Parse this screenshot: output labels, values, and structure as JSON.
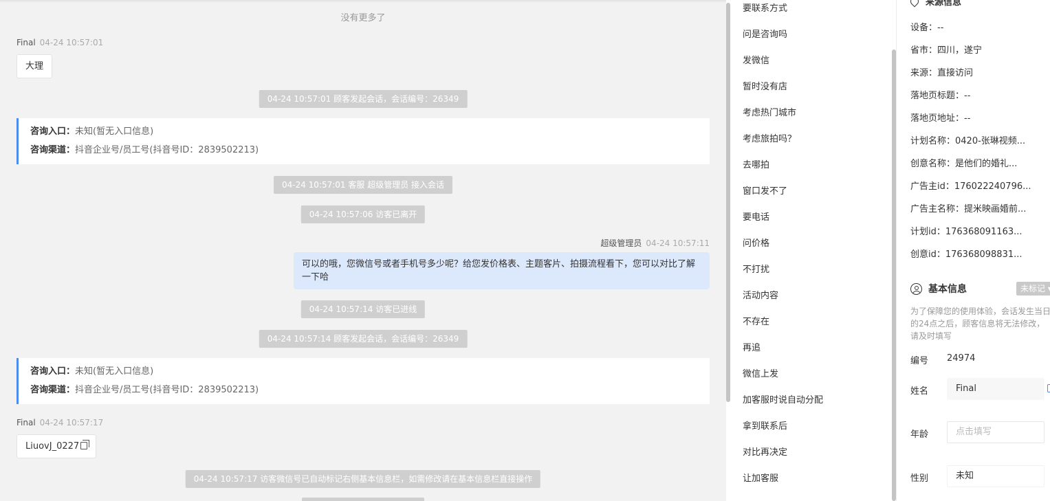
{
  "chat": {
    "no_more": "没有更多了",
    "msg1": {
      "sender": "Final",
      "time": "04-24 10:57:01",
      "text": "大理"
    },
    "sys1": "04-24 10:57:01 顾客发起会话，会话编号：26349",
    "card1": {
      "entry_label": "咨询入口：",
      "entry_value": "未知(暂无入口信息)",
      "channel_label": "咨询渠道：",
      "channel_value": "抖音企业号/员工号(抖音号ID：2839502213)"
    },
    "sys2": "04-24 10:57:01 客服 超级管理员 接入会话",
    "sys3": "04-24 10:57:06 访客已离开",
    "msg2": {
      "sender": "超级管理员",
      "time": "04-24 10:57:11",
      "text": "可以的哦，您微信号或者手机号多少呢？给您发价格表、主题客片、拍摄流程看下，您可以对比了解一下哈"
    },
    "sys4": "04-24 10:57:14 访客已进线",
    "sys5": "04-24 10:57:14 顾客发起会话，会话编号：26349",
    "card2": {
      "entry_label": "咨询入口：",
      "entry_value": "未知(暂无入口信息)",
      "channel_label": "咨询渠道：",
      "channel_value": "抖音企业号/员工号(抖音号ID：2839502213)"
    },
    "msg3": {
      "sender": "Final",
      "time": "04-24 10:57:17",
      "text": "LiuovJ_0227"
    },
    "sys6": "04-24 10:57:17 访客微信号已自动标记右侧基本信息栏，如需修改请在基本信息栏直接操作"
  },
  "quick_replies": [
    "要联系方式",
    "问是咨询吗",
    "发微信",
    "暂时没有店",
    "考虑热门城市",
    "考虑旅拍吗？",
    "去哪拍",
    "窗口发不了",
    "要电话",
    "问价格",
    "不打扰",
    "活动内容",
    "不存在",
    "再追",
    "微信上发",
    "加客服时说自动分配",
    "拿到联系后",
    "对比再决定",
    "让加客服"
  ],
  "source": {
    "title": "来源信息",
    "rows": [
      "设备：--",
      "省市：四川，遂宁",
      "来源：直接访问",
      "落地页标题：--",
      "落地页地址：--",
      "计划名称：0420-张琳视频...",
      "创意名称：是他们的婚礼...",
      "广告主id：176022240796...",
      "广告主名称：提米映画婚前...",
      "计划id：176368091163...",
      "创意id：176368098831..."
    ]
  },
  "basic": {
    "title": "基本信息",
    "tag": "未标记",
    "tip": "为了保障您的使用体验，会话发生当日的24点之后，顾客信息将无法修改，请及时填写",
    "id_label": "编号",
    "id_value": "24974",
    "name_label": "姓名",
    "name_value": "Final",
    "age_label": "年龄",
    "age_placeholder": "点击填写",
    "gender_label": "性别",
    "gender_value": "未知"
  }
}
